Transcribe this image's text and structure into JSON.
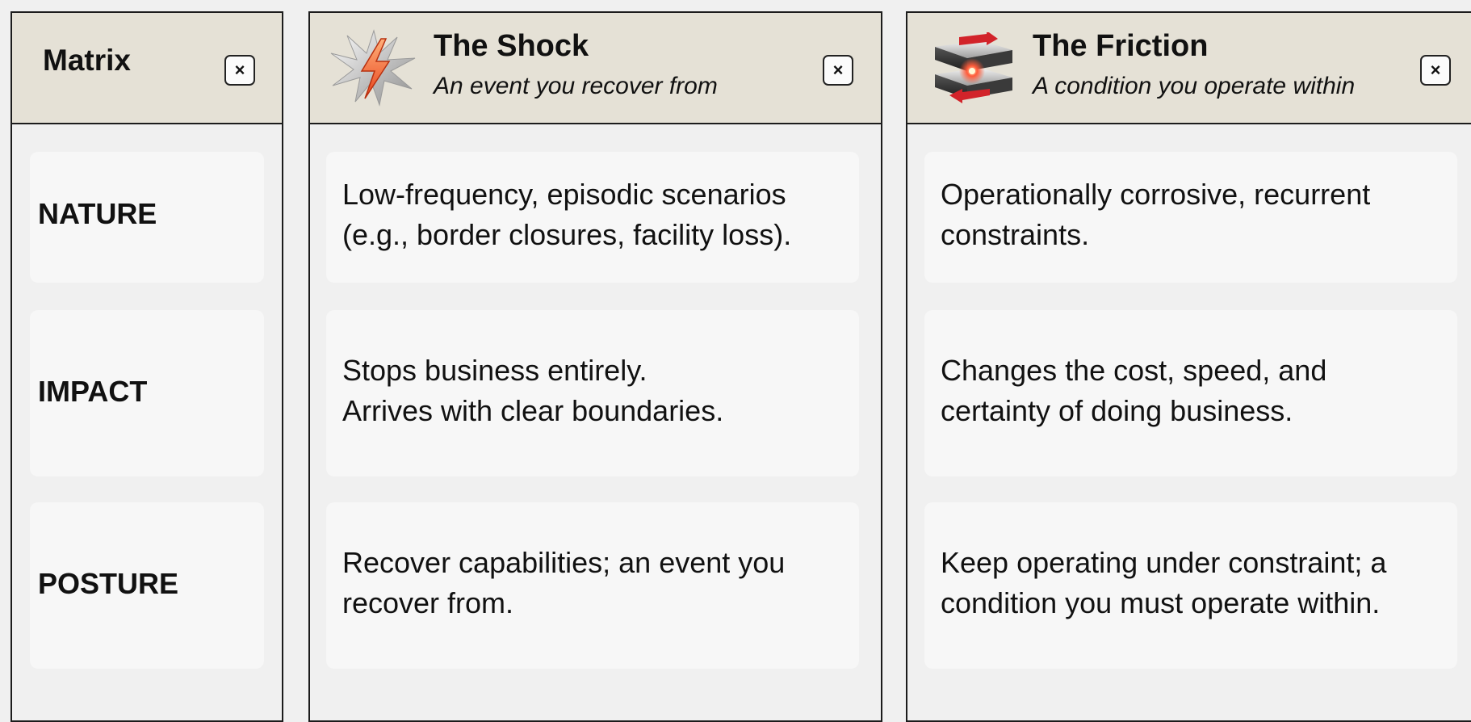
{
  "matrix": {
    "title": "Matrix",
    "rows": [
      {
        "label": "NATURE"
      },
      {
        "label": "IMPACT"
      },
      {
        "label": "POSTURE"
      }
    ]
  },
  "shock": {
    "title": "The Shock",
    "subtitle": "An event you recover from",
    "icon": "lightning-burst-icon",
    "cells": [
      {
        "line1": "Low-frequency, episodic scenarios",
        "line2": "(e.g., border closures, facility loss)."
      },
      {
        "line1": "Stops business entirely.",
        "line2": "Arrives with clear boundaries."
      },
      {
        "line1": "Recover capabilities; an event you",
        "line2": "recover from."
      }
    ]
  },
  "friction": {
    "title": "The Friction",
    "subtitle": "A condition you operate within",
    "icon": "grinding-plates-icon",
    "cells": [
      {
        "line1": "Operationally corrosive, recurrent",
        "line2": "constraints."
      },
      {
        "line1": "Changes the cost, speed, and",
        "line2": "certainty of doing business."
      },
      {
        "line1": "Keep operating under constraint; a",
        "line2": "condition you must operate within."
      }
    ]
  },
  "close_glyph": "×",
  "colors": {
    "header_bg": "#e5e1d6",
    "page_bg": "#f0f0f0",
    "card_bg": "#f7f7f7",
    "border": "#1c1c1c",
    "shock_accent": "#f05a2a",
    "friction_accent": "#d2232a"
  }
}
